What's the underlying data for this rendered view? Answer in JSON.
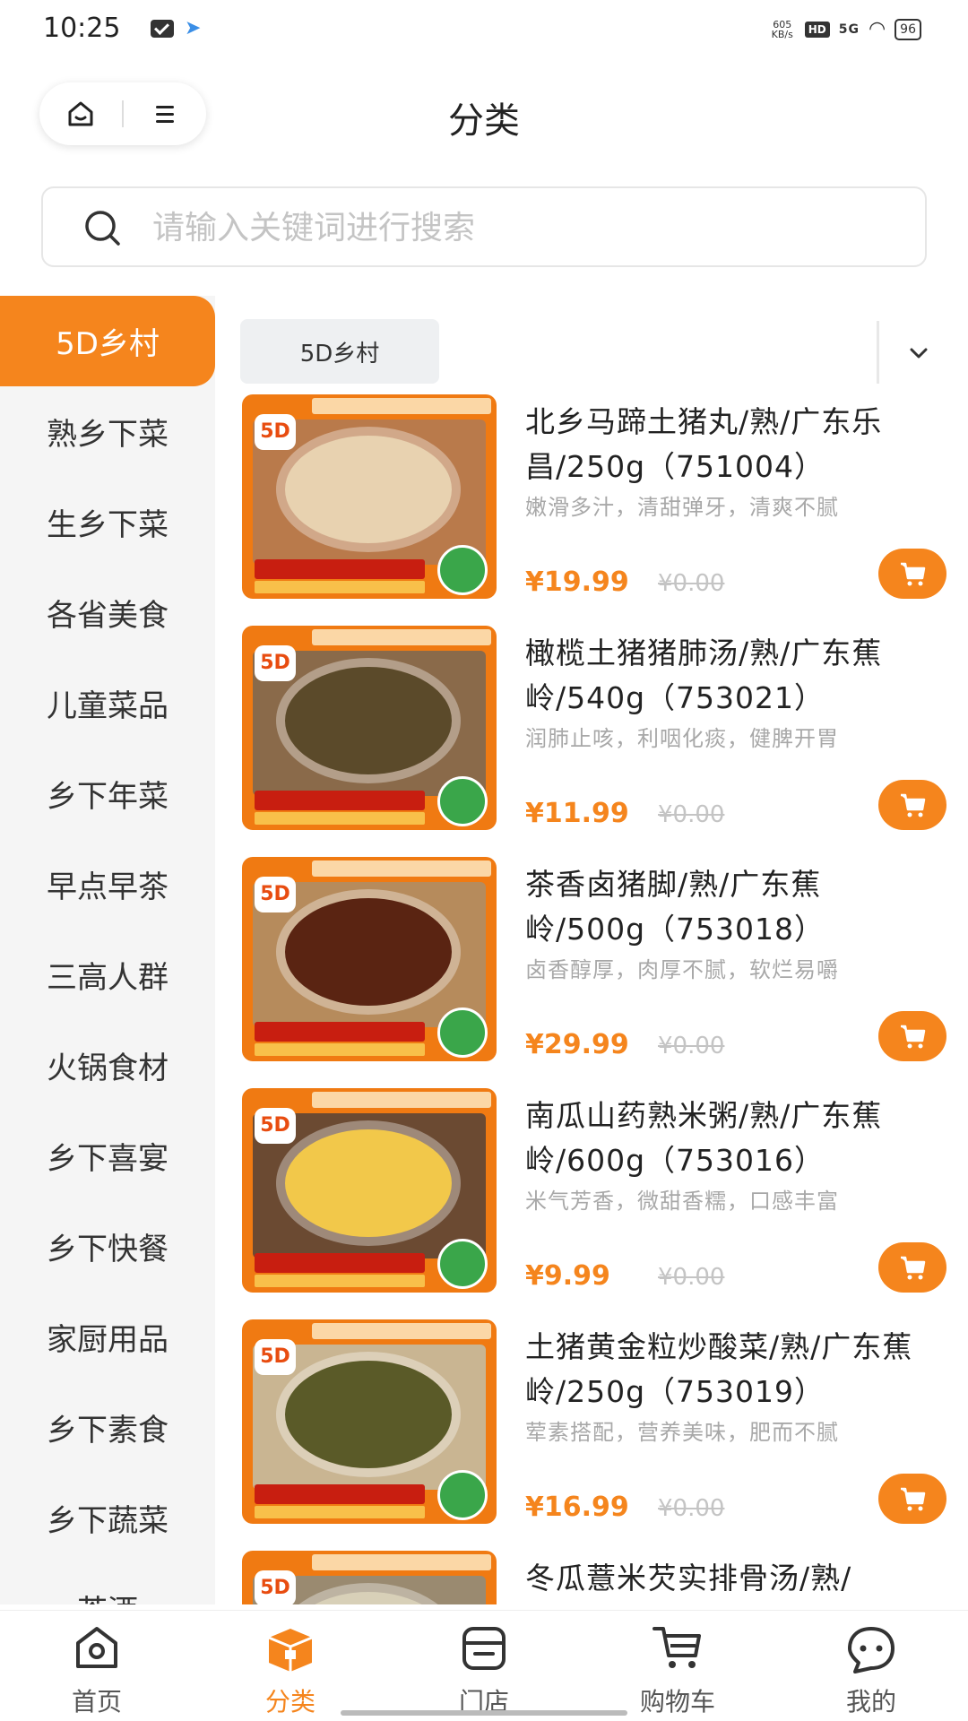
{
  "status_bar": {
    "time": "10:25",
    "net_speed": "605 KB/s",
    "hd": "HD",
    "signal": "5G",
    "battery": "96"
  },
  "header": {
    "title": "分类"
  },
  "search": {
    "placeholder": "请输入关键词进行搜索"
  },
  "sidebar": {
    "items": [
      {
        "label": "5D乡村",
        "active": true
      },
      {
        "label": "熟乡下菜"
      },
      {
        "label": "生乡下菜"
      },
      {
        "label": "各省美食"
      },
      {
        "label": "儿童菜品"
      },
      {
        "label": "乡下年菜"
      },
      {
        "label": "早点早茶"
      },
      {
        "label": "三高人群"
      },
      {
        "label": "火锅食材"
      },
      {
        "label": "乡下喜宴"
      },
      {
        "label": "乡下快餐"
      },
      {
        "label": "家厨用品"
      },
      {
        "label": "乡下素食"
      },
      {
        "label": "乡下蔬菜"
      },
      {
        "label": "茶酒"
      }
    ]
  },
  "sub_tabs": [
    {
      "label": "5D乡村"
    }
  ],
  "products": [
    {
      "name": "北乡马蹄土猪丸/熟/广东乐昌/250g（751004）",
      "desc": "嫩滑多汁，清甜弹牙，清爽不腻",
      "price": "¥19.99",
      "old_price": "¥0.00",
      "photo_color": "#b97a4b",
      "dish_color": "#e8d2b0"
    },
    {
      "name": "橄榄土猪猪肺汤/熟/广东蕉岭/540g（753021）",
      "desc": "润肺止咳，利咽化痰，健脾开胃",
      "price": "¥11.99",
      "old_price": "¥0.00",
      "photo_color": "#8a6a4a",
      "dish_color": "#5b4a2a"
    },
    {
      "name": "茶香卤猪脚/熟/广东蕉岭/500g（753018）",
      "desc": "卤香醇厚，肉厚不腻，软烂易嚼",
      "price": "¥29.99",
      "old_price": "¥0.00",
      "photo_color": "#b68b5c",
      "dish_color": "#5a2412"
    },
    {
      "name": "南瓜山药熟米粥/熟/广东蕉岭/600g（753016）",
      "desc": "米气芳香，微甜香糯，口感丰富",
      "price": "¥9.99",
      "old_price": "¥0.00",
      "photo_color": "#6b4a32",
      "dish_color": "#f2c84a"
    },
    {
      "name": "土猪黄金粒炒酸菜/熟/广东蕉岭/250g（753019）",
      "desc": "荤素搭配，营养美味，肥而不腻",
      "price": "¥16.99",
      "old_price": "¥0.00",
      "photo_color": "#c9b592",
      "dish_color": "#5a5a28"
    },
    {
      "name": "冬瓜薏米芡实排骨汤/熟/",
      "desc": "",
      "price": "",
      "old_price": "",
      "photo_color": "#9a8a70",
      "dish_color": "#d8d0b8"
    }
  ],
  "tabbar": {
    "items": [
      {
        "label": "首页",
        "icon": "home-icon"
      },
      {
        "label": "分类",
        "icon": "category-box-icon",
        "active": true
      },
      {
        "label": "门店",
        "icon": "store-icon"
      },
      {
        "label": "购物车",
        "icon": "cart-icon"
      },
      {
        "label": "我的",
        "icon": "profile-icon"
      }
    ]
  },
  "colors": {
    "accent": "#f5851d",
    "sidebar_bg": "#f5f5f5",
    "muted_text": "#a8a8a8"
  }
}
